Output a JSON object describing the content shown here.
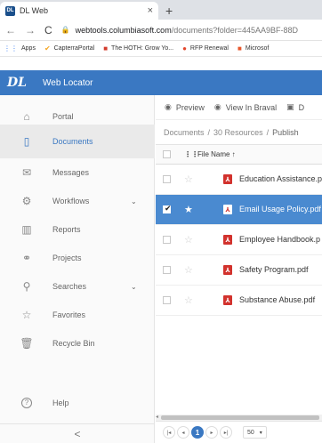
{
  "browser": {
    "tab_title": "DL Web",
    "tab_close": "×",
    "new_tab": "+",
    "favicon_text": "DL",
    "url_host": "webtools.columbiasoft.com",
    "url_path": "/documents?folder=445AA9BF-88D",
    "nav": {
      "back": "←",
      "forward": "→",
      "reload": "C"
    },
    "bookmarks": [
      {
        "icon": "⋮⋮",
        "label": "Apps"
      },
      {
        "icon": "✔",
        "label": "CapterraPortal"
      },
      {
        "icon": "■",
        "label": "The HOTH: Grow Yo..."
      },
      {
        "icon": "●",
        "label": "RFP Renewal"
      },
      {
        "icon": "■",
        "label": "Microsof"
      }
    ]
  },
  "app": {
    "logo": "DL",
    "title": "Web Locator"
  },
  "sidebar": {
    "items": [
      {
        "label": "Portal",
        "icon": "home-icon",
        "glyph": "⌂"
      },
      {
        "label": "Documents",
        "icon": "document-icon",
        "glyph": "▯"
      },
      {
        "label": "Messages",
        "icon": "envelope-icon",
        "glyph": "✉"
      },
      {
        "label": "Workflows",
        "icon": "workflow-icon",
        "glyph": "⚙",
        "caret": "⌄"
      },
      {
        "label": "Reports",
        "icon": "bar-chart-icon",
        "glyph": "▥"
      },
      {
        "label": "Projects",
        "icon": "projects-icon",
        "glyph": "⚭"
      },
      {
        "label": "Searches",
        "icon": "search-icon",
        "glyph": "⚲",
        "caret": "⌄"
      },
      {
        "label": "Favorites",
        "icon": "star-icon",
        "glyph": "☆"
      },
      {
        "label": "Recycle Bin",
        "icon": "trash-icon",
        "glyph": "🗑"
      },
      {
        "label": "Help",
        "icon": "help-icon",
        "glyph": "?"
      }
    ],
    "active_index": 1,
    "collapse": "<"
  },
  "toolbar": {
    "preview": "Preview",
    "view_in_braval": "View In Braval",
    "third": "D"
  },
  "breadcrumb": {
    "root": "Documents",
    "sep": "/",
    "middle": "30 Resources",
    "current": "Publish"
  },
  "table": {
    "header_name": "File Name ↑",
    "header_dots": "⋮",
    "rows": [
      {
        "name": "Education Assistance.p",
        "selected": false
      },
      {
        "name": "Email Usage Policy.pdf",
        "selected": true
      },
      {
        "name": "Employee Handbook.p",
        "selected": false
      },
      {
        "name": "Safety Program.pdf",
        "selected": false
      },
      {
        "name": "Substance Abuse.pdf",
        "selected": false
      }
    ],
    "star_glyph": "☆",
    "star_filled": "★",
    "pdf_glyph": "⅄",
    "check": "✔"
  },
  "pager": {
    "first": "|◂",
    "prev": "◂",
    "current": "1",
    "next": "▸",
    "last": "▸|",
    "page_size": "50",
    "page_size_caret": "▾"
  },
  "colors": {
    "brand": "#3a78c2",
    "selected_row": "#4a8ad0",
    "pdf": "#d2322d"
  }
}
